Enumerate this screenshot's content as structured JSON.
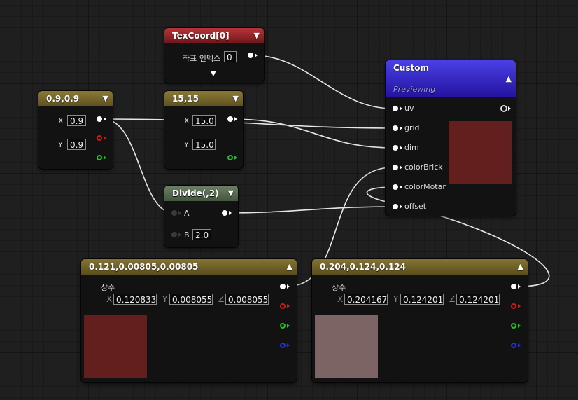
{
  "nodes": {
    "texcoord": {
      "title": "TexCoord[0]",
      "label": "좌표 인덱스",
      "value": "0"
    },
    "c09": {
      "title": "0.9,0.9",
      "x_label": "X",
      "x": "0.9",
      "y_label": "Y",
      "y": "0.9"
    },
    "c1515": {
      "title": "15,15",
      "x_label": "X",
      "x": "15.0",
      "y_label": "Y",
      "y": "15.0"
    },
    "divide": {
      "title": "Divide(,2)",
      "a_label": "A",
      "b_label": "B",
      "b": "2.0"
    },
    "custom": {
      "title": "Custom",
      "subtitle": "Previewing",
      "inputs": [
        "uv",
        "grid",
        "dim",
        "colorBrick",
        "colorMotar",
        "offset"
      ],
      "preview_color": "#621f1e"
    },
    "const1": {
      "title": "0.121,0.00805,0.00805",
      "label": "상수",
      "x_label": "X",
      "x": "0.120833",
      "y_label": "Y",
      "y": "0.008055",
      "z_label": "Z",
      "z": "0.008055",
      "preview_color": "#621f1e"
    },
    "const2": {
      "title": "0.204,0.124,0.124",
      "label": "상수",
      "x_label": "X",
      "x": "0.204167",
      "y_label": "Y",
      "y": "0.124201",
      "z_label": "Z",
      "z": "0.124201",
      "preview_color": "#7c6465"
    }
  },
  "icons": {
    "collapse": "chevron-down-icon",
    "expand": "chevron-up-icon",
    "pin": "pin-circle-icon"
  },
  "colors": {
    "gold_header": "#7a6a2c",
    "red_header": "#9e2228",
    "green_header": "#5a6e54",
    "blue_header": "#3a2ed0",
    "wire": "#e8e8e8"
  }
}
